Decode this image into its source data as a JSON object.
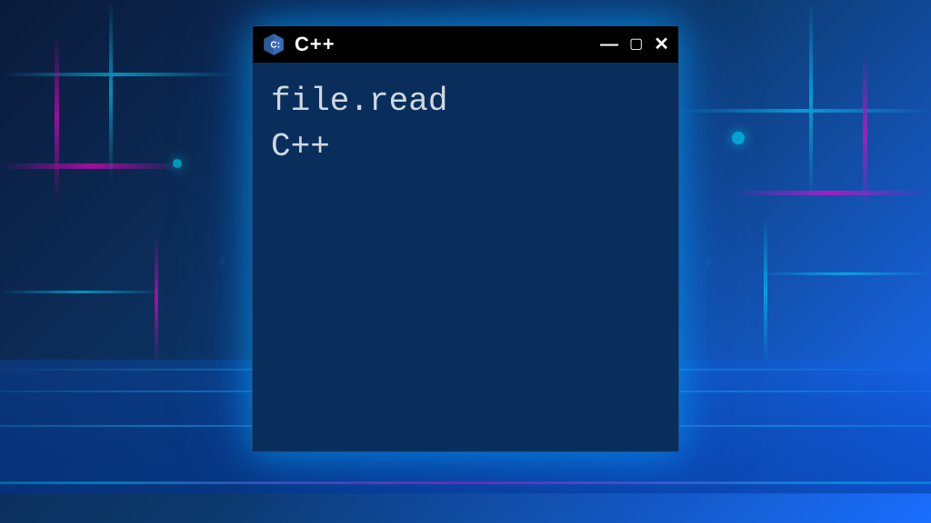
{
  "window": {
    "title": "C++",
    "icon": "cpp-logo-icon"
  },
  "content": {
    "lines": [
      "file.read",
      "C++"
    ]
  },
  "controls": {
    "minimize": "—",
    "maximize": "▢",
    "close": "✕"
  }
}
